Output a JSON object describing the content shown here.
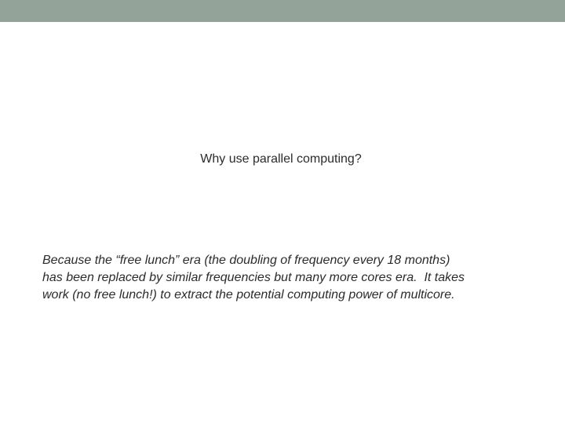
{
  "slide": {
    "title": "Why use parallel computing?",
    "body_lines": [
      "Because the “free lunch” era (the doubling of frequency every 18 months)",
      "has been replaced by similar frequencies but many more cores era.  It takes",
      "work (no free lunch!) to extract the potential computing power of multicore."
    ]
  },
  "colors": {
    "top_bar": "#94a39a",
    "background": "#ffffff",
    "text": "#2b2b2b"
  }
}
